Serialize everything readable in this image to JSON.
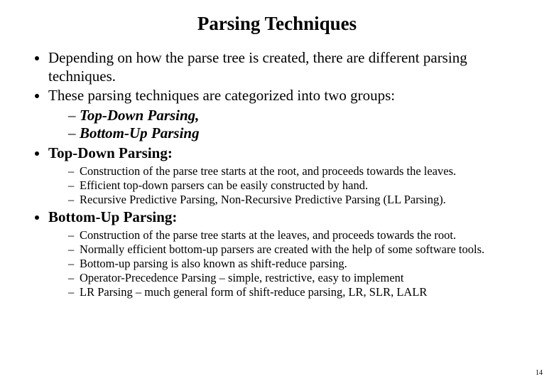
{
  "title": "Parsing Techniques",
  "b1": "Depending on how the parse tree is created, there are different parsing techniques.",
  "b2": "These parsing techniques are categorized into two groups:",
  "b2a": "Top-Down Parsing,",
  "b2b": "Bottom-Up Parsing",
  "b3": "Top-Down Parsing:",
  "td1": "Construction of the parse tree starts at the root, and proceeds towards the leaves.",
  "td2": "Efficient top-down parsers can be easily constructed by hand.",
  "td3": "Recursive Predictive Parsing, Non-Recursive Predictive Parsing (LL Parsing).",
  "b4": "Bottom-Up Parsing:",
  "bu1": "Construction of the parse tree starts at the leaves, and proceeds towards the root.",
  "bu2": "Normally efficient bottom-up parsers are created with the help of some software tools.",
  "bu3": "Bottom-up parsing is also known as shift-reduce parsing.",
  "bu4": "Operator-Precedence Parsing – simple, restrictive, easy to implement",
  "bu5": "LR Parsing – much general form of shift-reduce parsing, LR, SLR, LALR",
  "page": "14"
}
